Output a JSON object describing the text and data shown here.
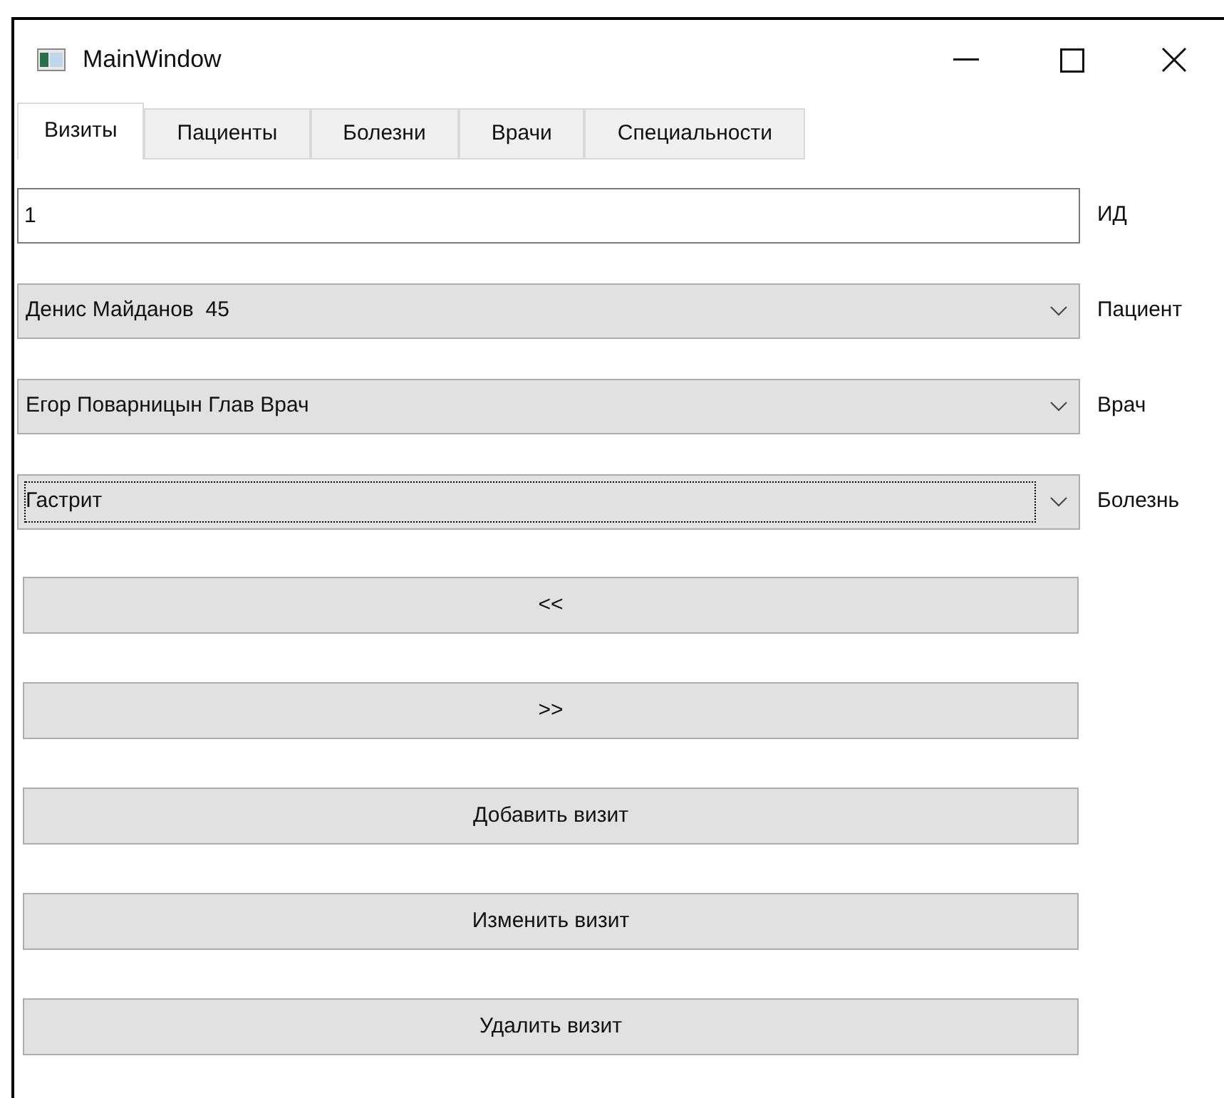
{
  "window": {
    "title": "MainWindow"
  },
  "tabs": [
    {
      "label": "Визиты",
      "selected": true
    },
    {
      "label": "Пациенты",
      "selected": false
    },
    {
      "label": "Болезни",
      "selected": false
    },
    {
      "label": "Врачи",
      "selected": false
    },
    {
      "label": "Специальности",
      "selected": false
    }
  ],
  "id_field": {
    "value": "1",
    "label": "ИД"
  },
  "combos": [
    {
      "value": "Денис Майданов  45",
      "label": "Пациент",
      "focused": false
    },
    {
      "value": "Егор Поварницын Глав Врач",
      "label": "Врач",
      "focused": false
    },
    {
      "value": "Гастрит",
      "label": "Болезнь",
      "focused": true
    }
  ],
  "buttons": [
    "<<",
    ">>",
    "Добавить визит",
    "Изменить визит",
    "Удалить визит"
  ]
}
